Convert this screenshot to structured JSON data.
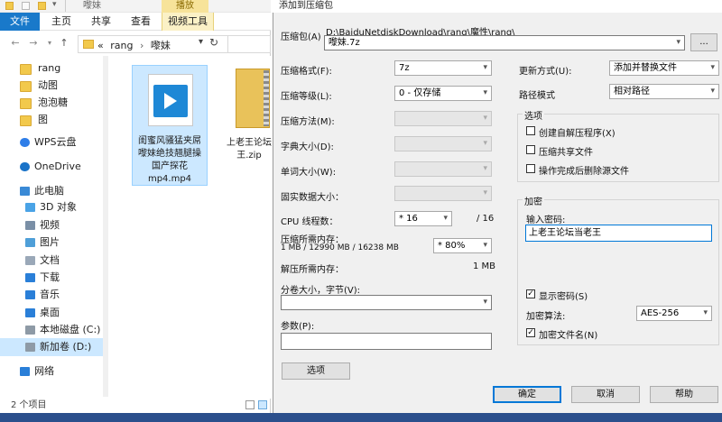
{
  "explorer": {
    "window_title": "嚟妹",
    "context_tab_top": "播放",
    "ribbon_tabs": [
      "文件",
      "主页",
      "共享",
      "查看",
      "视频工具"
    ],
    "address": {
      "chevron": "«",
      "path": [
        "rang",
        "嚟妹"
      ],
      "separator": "›"
    },
    "nav_items": [
      {
        "label": "rang",
        "icon": "folder-icon"
      },
      {
        "label": "动图",
        "icon": "folder-icon"
      },
      {
        "label": "泡泡糖",
        "icon": "folder-icon"
      },
      {
        "label": "图",
        "icon": "folder-icon"
      },
      {
        "label": "WPS云盘",
        "icon": "cloud-icon"
      },
      {
        "label": "OneDrive",
        "icon": "onedrive-icon"
      },
      {
        "label": "此电脑",
        "icon": "computer-icon"
      },
      {
        "label": "3D 对象",
        "icon": "3d-objects-icon"
      },
      {
        "label": "视频",
        "icon": "video-icon"
      },
      {
        "label": "图片",
        "icon": "pictures-icon"
      },
      {
        "label": "文档",
        "icon": "documents-icon"
      },
      {
        "label": "下载",
        "icon": "download-icon"
      },
      {
        "label": "音乐",
        "icon": "music-icon"
      },
      {
        "label": "桌面",
        "icon": "desktop-icon"
      },
      {
        "label": "本地磁盘 (C:)",
        "icon": "disk-icon"
      },
      {
        "label": "新加卷 (D:)",
        "icon": "disk-icon"
      },
      {
        "label": "网络",
        "icon": "network-icon"
      }
    ],
    "files": [
      {
        "name_lines": [
          "闺蜜风骚猛夹屌",
          "嚟妹绝技翘腿操",
          "国产探花",
          "mp4.mp4"
        ],
        "type": "mp4"
      },
      {
        "name_lines": [
          "上老王论坛",
          "王.zip"
        ],
        "type": "zip"
      }
    ],
    "status": "2 个项目"
  },
  "dialog": {
    "title": "添加到压缩包",
    "archive_label": "压缩包(A)",
    "archive_dir": "D:\\BaiduNetdiskDownload\\rang\\魔性\\rang\\",
    "archive_name": "嚟妹.7z",
    "browse_label": "...",
    "format_label": "压缩格式(F):",
    "format_value": "7z",
    "level_label": "压缩等级(L):",
    "level_value": "0 - 仅存储",
    "method_label": "压缩方法(M):",
    "dict_label": "字典大小(D):",
    "word_label": "单词大小(W):",
    "solid_label": "固实数据大小：",
    "cpu_label": "CPU 线程数：",
    "cpu_value": "* 16",
    "cpu_total": "/ 16",
    "mem_comp_label": "压缩所需内存：",
    "mem_comp_detail": "1 MB / 12990 MB / 16238 MB",
    "mem_comp_pct": "* 80%",
    "mem_decomp_label": "解压所需内存：",
    "mem_decomp_value": "1 MB",
    "split_label": "分卷大小，字节(V):",
    "params_label": "参数(P):",
    "options_button": "选项",
    "update_label": "更新方式(U):",
    "update_value": "添加并替换文件",
    "path_label": "路径模式",
    "path_value": "相对路径",
    "options_group": "选项",
    "opt_sfx": "创建自解压程序(X)",
    "opt_shared": "压缩共享文件",
    "opt_delete": "操作完成后删除源文件",
    "enc_group": "加密",
    "enc_pwd_label": "输入密码:",
    "enc_pwd_value": "上老王论坛当老王",
    "show_pwd": "显示密码(S)",
    "enc_method_label": "加密算法:",
    "enc_method_value": "AES-256",
    "enc_names": "加密文件名(N)",
    "ok": "确定",
    "cancel": "取消",
    "help": "帮助",
    "checked": {
      "show_pwd": true,
      "enc_names": true,
      "opt_sfx": false,
      "opt_shared": false,
      "opt_delete": false
    }
  }
}
